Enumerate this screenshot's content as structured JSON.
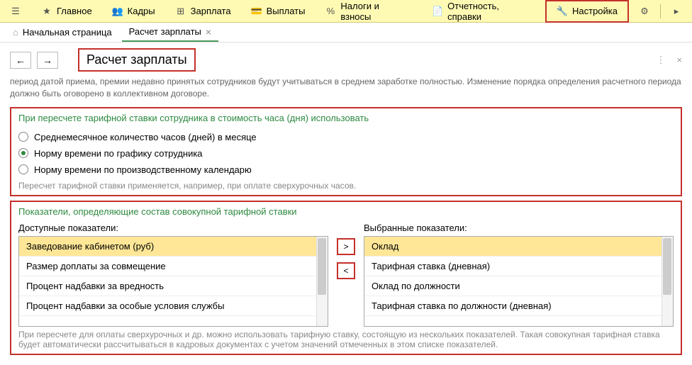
{
  "toolbar": {
    "items": [
      {
        "label": "Главное"
      },
      {
        "label": "Кадры"
      },
      {
        "label": "Зарплата"
      },
      {
        "label": "Выплаты"
      },
      {
        "label": "Налоги и взносы"
      },
      {
        "label": "Отчетность, справки"
      },
      {
        "label": "Настройка"
      }
    ]
  },
  "tabs": {
    "home": "Начальная страница",
    "active": "Расчет зарплаты"
  },
  "page": {
    "title": "Расчет зарплаты",
    "intro": "период датой приема, премии недавно принятых сотрудников будут учитываться в среднем заработке полностью. Изменение порядка определения расчетного периода должно быть оговорено в коллективном договоре."
  },
  "section1": {
    "title": "При пересчете тарифной ставки сотрудника в стоимость часа (дня) использовать",
    "options": [
      "Среднемесячное количество часов (дней) в месяце",
      "Норму времени по графику сотрудника",
      "Норму времени по производственному календарю"
    ],
    "hint": "Пересчет тарифной ставки применяется, например, при оплате сверхурочных часов."
  },
  "section2": {
    "title": "Показатели, определяющие состав совокупной тарифной ставки",
    "available_label": "Доступные показатели:",
    "available": [
      "Заведование кабинетом (руб)",
      "Размер доплаты за совмещение",
      "Процент надбавки за вредность",
      "Процент надбавки за особые условия службы"
    ],
    "selected_label": "Выбранные показатели:",
    "selected": [
      "Оклад",
      "Тарифная ставка (дневная)",
      "Оклад по должности",
      "Тарифная ставка по должности (дневная)"
    ],
    "move_right": ">",
    "move_left": "<",
    "hint": "При пересчете для оплаты сверхурочных и др. можно использовать тарифную ставку, состоящую из нескольких показателей. Такая совокупная тарифная ставка будет автоматически рассчитываться в кадровых документах с учетом значений отмеченных в этом списке показателей."
  }
}
